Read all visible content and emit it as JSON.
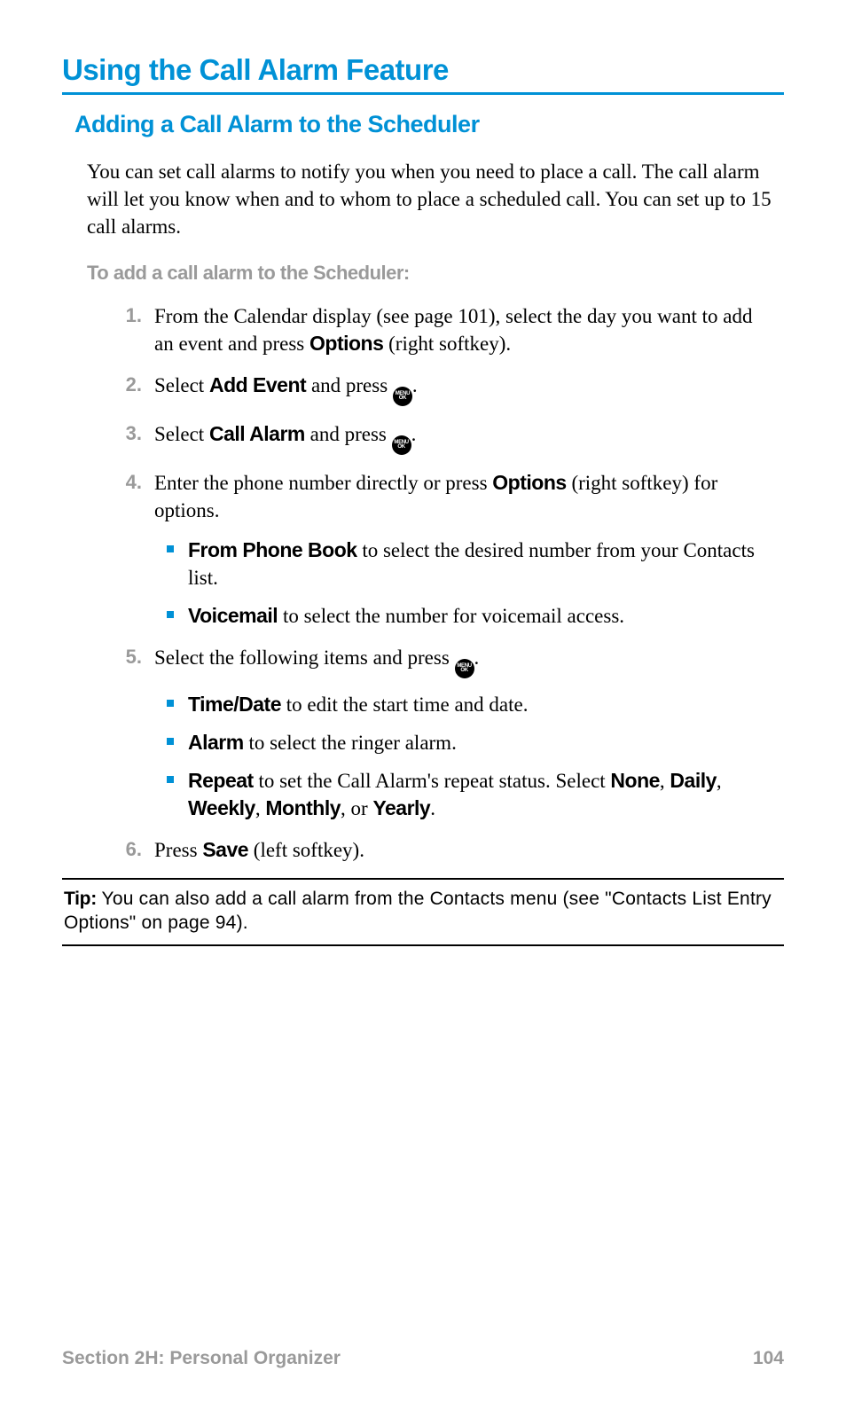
{
  "h1": "Using the Call Alarm Feature",
  "h2": "Adding a Call Alarm to the Scheduler",
  "intro": "You can set call alarms to notify you when you need to place a call. The call alarm will let you know when and to whom to place a scheduled call. You can set up to 15 call alarms.",
  "proc_label": "To add a call alarm to the Scheduler:",
  "steps": {
    "s1": {
      "num": "1.",
      "a": "From the Calendar display (see page 101), select the day you want to add an event and press ",
      "b": "Options",
      "c": " (right softkey)."
    },
    "s2": {
      "num": "2.",
      "a": "Select ",
      "b": "Add Event",
      "c": " and press ",
      "d": "."
    },
    "s3": {
      "num": "3.",
      "a": "Select ",
      "b": "Call Alarm",
      "c": " and press ",
      "d": "."
    },
    "s4": {
      "num": "4.",
      "a": "Enter the phone number directly or press ",
      "b": "Options",
      "c": " (right softkey) for options.",
      "sub": {
        "i1": {
          "b": "From Phone Book",
          "t": " to select the desired number from your Contacts list."
        },
        "i2": {
          "b": "Voicemail",
          "t": " to select the number for voicemail access."
        }
      }
    },
    "s5": {
      "num": "5.",
      "a": "Select the following items and press ",
      "d": ".",
      "sub": {
        "i1": {
          "b": "Time/Date",
          "t": " to edit the start time and date."
        },
        "i2": {
          "b": "Alarm",
          "t": " to select the ringer alarm."
        },
        "i3": {
          "b": "Repeat",
          "t1": " to set the Call Alarm's repeat status. Select ",
          "o1": "None",
          "c1": ", ",
          "o2": "Daily",
          "c2": ", ",
          "o3": "Weekly",
          "c3": ", ",
          "o4": "Monthly",
          "c4": ", or ",
          "o5": "Yearly",
          "c5": "."
        }
      }
    },
    "s6": {
      "num": "6.",
      "a": "Press ",
      "b": "Save",
      "c": " (left softkey)."
    }
  },
  "tip": {
    "label": "Tip:",
    "text": " You can also add a call alarm from the Contacts menu (see \"Contacts List Entry Options\" on page 94)."
  },
  "footer": {
    "section": "Section 2H: Personal Organizer",
    "page": "104"
  },
  "icon": {
    "t1": "MENU",
    "t2": "OK"
  }
}
